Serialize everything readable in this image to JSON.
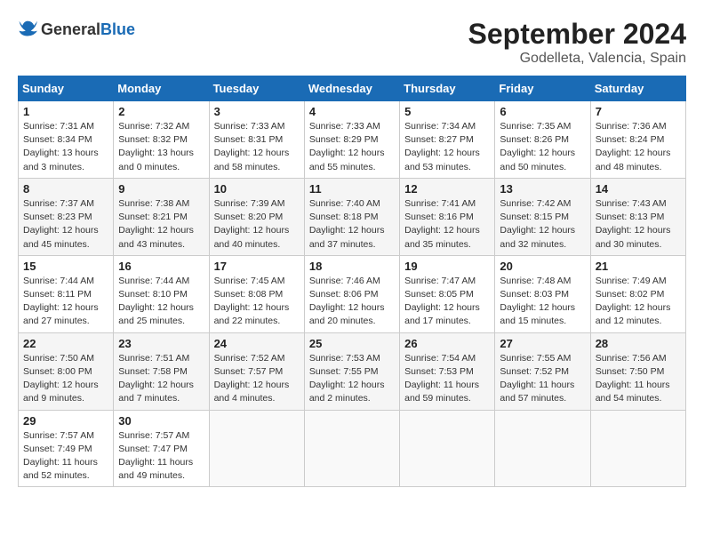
{
  "header": {
    "logo_general": "General",
    "logo_blue": "Blue",
    "month": "September 2024",
    "location": "Godelleta, Valencia, Spain"
  },
  "calendar": {
    "days_of_week": [
      "Sunday",
      "Monday",
      "Tuesday",
      "Wednesday",
      "Thursday",
      "Friday",
      "Saturday"
    ],
    "weeks": [
      [
        {
          "day": "1",
          "sunrise": "7:31 AM",
          "sunset": "8:34 PM",
          "daylight": "13 hours and 3 minutes."
        },
        {
          "day": "2",
          "sunrise": "7:32 AM",
          "sunset": "8:32 PM",
          "daylight": "13 hours and 0 minutes."
        },
        {
          "day": "3",
          "sunrise": "7:33 AM",
          "sunset": "8:31 PM",
          "daylight": "12 hours and 58 minutes."
        },
        {
          "day": "4",
          "sunrise": "7:33 AM",
          "sunset": "8:29 PM",
          "daylight": "12 hours and 55 minutes."
        },
        {
          "day": "5",
          "sunrise": "7:34 AM",
          "sunset": "8:27 PM",
          "daylight": "12 hours and 53 minutes."
        },
        {
          "day": "6",
          "sunrise": "7:35 AM",
          "sunset": "8:26 PM",
          "daylight": "12 hours and 50 minutes."
        },
        {
          "day": "7",
          "sunrise": "7:36 AM",
          "sunset": "8:24 PM",
          "daylight": "12 hours and 48 minutes."
        }
      ],
      [
        {
          "day": "8",
          "sunrise": "7:37 AM",
          "sunset": "8:23 PM",
          "daylight": "12 hours and 45 minutes."
        },
        {
          "day": "9",
          "sunrise": "7:38 AM",
          "sunset": "8:21 PM",
          "daylight": "12 hours and 43 minutes."
        },
        {
          "day": "10",
          "sunrise": "7:39 AM",
          "sunset": "8:20 PM",
          "daylight": "12 hours and 40 minutes."
        },
        {
          "day": "11",
          "sunrise": "7:40 AM",
          "sunset": "8:18 PM",
          "daylight": "12 hours and 37 minutes."
        },
        {
          "day": "12",
          "sunrise": "7:41 AM",
          "sunset": "8:16 PM",
          "daylight": "12 hours and 35 minutes."
        },
        {
          "day": "13",
          "sunrise": "7:42 AM",
          "sunset": "8:15 PM",
          "daylight": "12 hours and 32 minutes."
        },
        {
          "day": "14",
          "sunrise": "7:43 AM",
          "sunset": "8:13 PM",
          "daylight": "12 hours and 30 minutes."
        }
      ],
      [
        {
          "day": "15",
          "sunrise": "7:44 AM",
          "sunset": "8:11 PM",
          "daylight": "12 hours and 27 minutes."
        },
        {
          "day": "16",
          "sunrise": "7:44 AM",
          "sunset": "8:10 PM",
          "daylight": "12 hours and 25 minutes."
        },
        {
          "day": "17",
          "sunrise": "7:45 AM",
          "sunset": "8:08 PM",
          "daylight": "12 hours and 22 minutes."
        },
        {
          "day": "18",
          "sunrise": "7:46 AM",
          "sunset": "8:06 PM",
          "daylight": "12 hours and 20 minutes."
        },
        {
          "day": "19",
          "sunrise": "7:47 AM",
          "sunset": "8:05 PM",
          "daylight": "12 hours and 17 minutes."
        },
        {
          "day": "20",
          "sunrise": "7:48 AM",
          "sunset": "8:03 PM",
          "daylight": "12 hours and 15 minutes."
        },
        {
          "day": "21",
          "sunrise": "7:49 AM",
          "sunset": "8:02 PM",
          "daylight": "12 hours and 12 minutes."
        }
      ],
      [
        {
          "day": "22",
          "sunrise": "7:50 AM",
          "sunset": "8:00 PM",
          "daylight": "12 hours and 9 minutes."
        },
        {
          "day": "23",
          "sunrise": "7:51 AM",
          "sunset": "7:58 PM",
          "daylight": "12 hours and 7 minutes."
        },
        {
          "day": "24",
          "sunrise": "7:52 AM",
          "sunset": "7:57 PM",
          "daylight": "12 hours and 4 minutes."
        },
        {
          "day": "25",
          "sunrise": "7:53 AM",
          "sunset": "7:55 PM",
          "daylight": "12 hours and 2 minutes."
        },
        {
          "day": "26",
          "sunrise": "7:54 AM",
          "sunset": "7:53 PM",
          "daylight": "11 hours and 59 minutes."
        },
        {
          "day": "27",
          "sunrise": "7:55 AM",
          "sunset": "7:52 PM",
          "daylight": "11 hours and 57 minutes."
        },
        {
          "day": "28",
          "sunrise": "7:56 AM",
          "sunset": "7:50 PM",
          "daylight": "11 hours and 54 minutes."
        }
      ],
      [
        {
          "day": "29",
          "sunrise": "7:57 AM",
          "sunset": "7:49 PM",
          "daylight": "11 hours and 52 minutes."
        },
        {
          "day": "30",
          "sunrise": "7:57 AM",
          "sunset": "7:47 PM",
          "daylight": "11 hours and 49 minutes."
        },
        null,
        null,
        null,
        null,
        null
      ]
    ]
  }
}
